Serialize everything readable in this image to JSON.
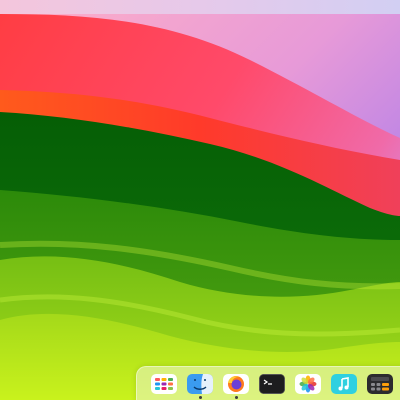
{
  "desktop": {
    "wallpaper": "sonoma-landscape",
    "palette": {
      "sky": "#c18cf0",
      "red_hill": "#ff3b3b",
      "orange_band": "#ff6a1f",
      "dark_green": "#0a6b0a",
      "mid_green": "#2e8c0a",
      "light_green": "#9ed81a",
      "lime": "#c7f11b"
    }
  },
  "dock": {
    "items": [
      {
        "name": "launchpad",
        "icon": "launchpad-icon",
        "running": false
      },
      {
        "name": "finder",
        "icon": "finder-icon",
        "running": true
      },
      {
        "name": "firefox",
        "icon": "firefox-icon",
        "running": true
      },
      {
        "name": "terminal",
        "icon": "terminal-icon",
        "running": false
      },
      {
        "name": "photos",
        "icon": "photos-icon",
        "running": false
      },
      {
        "name": "music",
        "icon": "music-icon",
        "running": false
      },
      {
        "name": "calculator",
        "icon": "calculator-icon",
        "running": false
      }
    ]
  }
}
